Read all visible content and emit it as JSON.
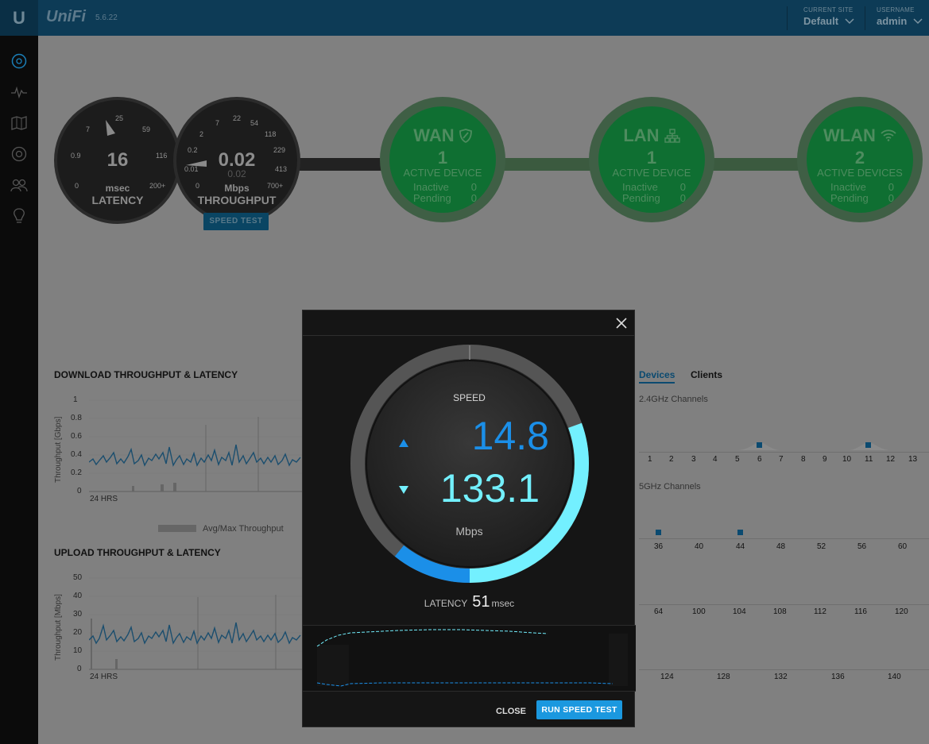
{
  "topbar": {
    "logo": "U",
    "brand": "UniFi",
    "version": "5.6.22",
    "current_site_label": "CURRENT SITE",
    "current_site_value": "Default",
    "username_label": "USERNAME",
    "username_value": "admin"
  },
  "sidebar": {
    "items": [
      "dashboard-icon",
      "statistics-icon",
      "map-icon",
      "devices-icon",
      "clients-icon",
      "insights-icon"
    ]
  },
  "gauges": {
    "latency": {
      "value": "16",
      "unit": "msec",
      "title": "LATENCY",
      "ticks": [
        "0",
        "0.9",
        "7",
        "25",
        "59",
        "116",
        "200+"
      ]
    },
    "throughput": {
      "value": "0.02",
      "sub_value": "0.02",
      "unit": "Mbps",
      "title": "THROUGHPUT",
      "ticks": [
        "0",
        "0.01",
        "0.2",
        "2",
        "7",
        "22",
        "54",
        "118",
        "229",
        "413",
        "700+"
      ]
    },
    "speed_test_label": "SPEED TEST"
  },
  "network": {
    "wan": {
      "title": "WAN",
      "count": "1",
      "active_label": "ACTIVE DEVICE",
      "inactive_label": "Inactive",
      "inactive": "0",
      "pending_label": "Pending",
      "pending": "0"
    },
    "lan": {
      "title": "LAN",
      "count": "1",
      "active_label": "ACTIVE DEVICE",
      "inactive_label": "Inactive",
      "inactive": "0",
      "pending_label": "Pending",
      "pending": "0"
    },
    "wlan": {
      "title": "WLAN",
      "count": "2",
      "active_label": "ACTIVE DEVICES",
      "inactive_label": "Inactive",
      "inactive": "0",
      "pending_label": "Pending",
      "pending": "0"
    }
  },
  "download_chart": {
    "title": "DOWNLOAD THROUGHPUT & LATENCY",
    "ylabel": "Throughput [Gbps]",
    "yticks": [
      "1",
      "0.8",
      "0.6",
      "0.4",
      "0.2",
      "0"
    ],
    "xlabel": "24 HRS",
    "legend": "Avg/Max Throughput"
  },
  "upload_chart": {
    "title": "UPLOAD THROUGHPUT & LATENCY",
    "ylabel": "Throughput [Mbps]",
    "yticks": [
      "50",
      "40",
      "30",
      "20",
      "10",
      "0"
    ],
    "xlabel": "24 HRS"
  },
  "channels": {
    "tabs": [
      "Devices",
      "Clients"
    ],
    "g24_title": "2.4GHz Channels",
    "g24": [
      "1",
      "2",
      "3",
      "4",
      "5",
      "6",
      "7",
      "8",
      "9",
      "10",
      "11",
      "12",
      "13"
    ],
    "g5_title": "5GHz Channels",
    "g5_row1": [
      "36",
      "40",
      "44",
      "48",
      "52",
      "56",
      "60"
    ],
    "g5_row2": [
      "64",
      "100",
      "104",
      "108",
      "112",
      "116",
      "120"
    ],
    "g5_row3": [
      "124",
      "128",
      "132",
      "136",
      "140"
    ]
  },
  "modal": {
    "speed_label": "SPEED",
    "upload_value": "14.8",
    "download_value": "133.1",
    "unit": "Mbps",
    "latency_label": "LATENCY",
    "latency_value": "51",
    "latency_unit": "msec",
    "close_label": "CLOSE",
    "run_label": "RUN SPEED TEST",
    "colors": {
      "upload": "#1b8fe8",
      "download": "#73f0ff"
    }
  }
}
